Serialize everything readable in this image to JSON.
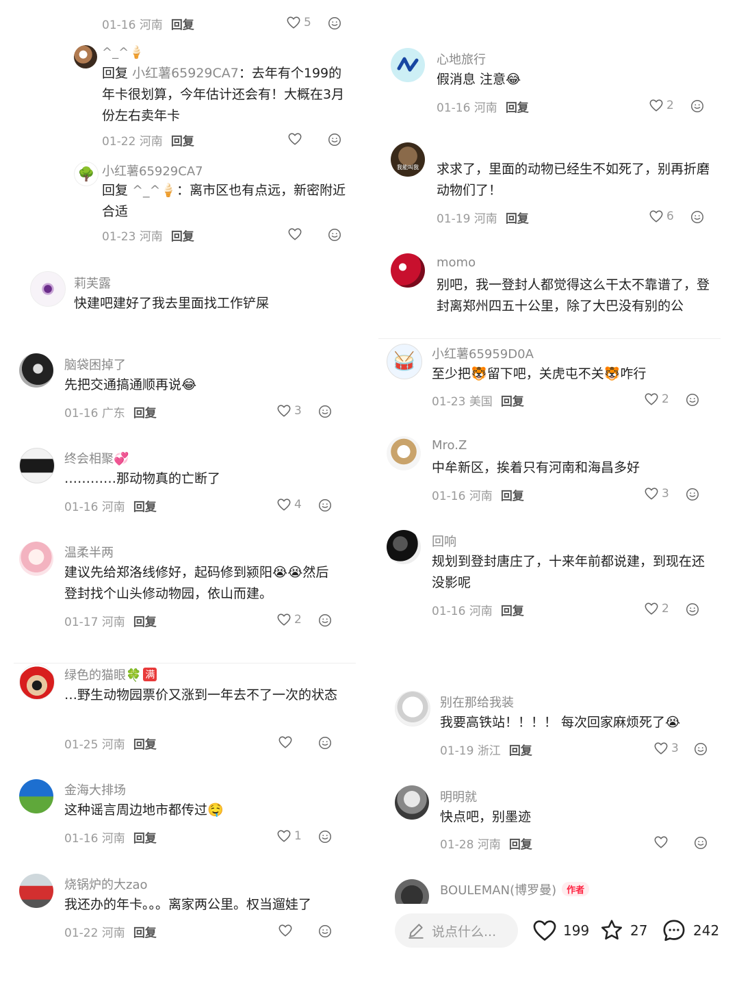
{
  "left": {
    "c0": {
      "date": "01-16",
      "loc": "河南",
      "reply": "回复",
      "likes": "5"
    },
    "c1": {
      "user": "^_^",
      "user_emoji": "🍦",
      "reply_prefix": "回复",
      "reply_to": "小红薯65929CA7",
      "text": "：去年有个199的年卡很划算，今年估计还会有！大概在3月份左右卖年卡",
      "date": "01-22",
      "loc": "河南",
      "reply": "回复",
      "likes": ""
    },
    "c2": {
      "user": "小红薯65929CA7",
      "reply_prefix": "回复",
      "reply_to": "^_^",
      "text_emoji": "🍦",
      "text": "：离市区也有点远，新密附近合适",
      "date": "01-23",
      "loc": "河南",
      "reply": "回复",
      "likes": ""
    },
    "c3": {
      "user": "莉芙露",
      "text": "快建吧建好了我去里面找工作铲屎"
    },
    "c4": {
      "user": "脑袋困掉了",
      "text": "先把交通搞通顺再说",
      "text_emoji": "😂",
      "date": "01-16",
      "loc": "广东",
      "reply": "回复",
      "likes": "3"
    },
    "c5": {
      "user": "终会相聚",
      "user_emoji": "💞",
      "text": "…………那动物真的亡断了",
      "date": "01-16",
      "loc": "河南",
      "reply": "回复",
      "likes": "4"
    },
    "c6": {
      "user": "温柔半两",
      "text_a": "建议先给郑洛线修好，起码修到颍阳",
      "emoji_a": "😭😭",
      "text_b": "然后登封找个山头修动物园，依山而建。",
      "date": "01-17",
      "loc": "河南",
      "reply": "回复",
      "likes": "2"
    },
    "c7": {
      "user": "绿色的猫眼",
      "user_emoji": "🍀",
      "user_tag": "满",
      "text": "…野生动物园票价又涨到一年去不了一次的状态",
      "date": "01-25",
      "loc": "河南",
      "reply": "回复",
      "likes": ""
    },
    "c8": {
      "user": "金海大排场",
      "text": "这种谣言周边地市都传过",
      "text_emoji": "🤤",
      "date": "01-16",
      "loc": "河南",
      "reply": "回复",
      "likes": "1"
    },
    "c9": {
      "user": "烧锅炉的大zao",
      "text": "我还办的年卡。。。离家两公里。权当遛娃了",
      "date": "01-22",
      "loc": "河南",
      "reply": "回复",
      "likes": ""
    }
  },
  "right": {
    "r1": {
      "user": "心地旅行",
      "text": "假消息 注意",
      "text_emoji": "😂",
      "date": "01-16",
      "loc": "河南",
      "reply": "回复",
      "likes": "2"
    },
    "r2": {
      "user": "",
      "avatar_text": "我能叫我",
      "text": "求求了，里面的动物已经生不如死了，别再折磨动物们了！",
      "date": "01-19",
      "loc": "河南",
      "reply": "回复",
      "likes": "6"
    },
    "r3": {
      "user": "momo",
      "text": "别吧，我一登封人都觉得这么干太不靠谱了，登封离郑州四五十公里，除了大巴没有别的公"
    },
    "r4": {
      "user": "小红薯65959D0A",
      "text_a": "至少把",
      "emoji_a": "🐯",
      "text_b": "留下吧，关虎屯不关",
      "emoji_b": "🐯",
      "text_c": "咋行",
      "date": "01-23",
      "loc": "美国",
      "reply": "回复",
      "likes": "2"
    },
    "r5": {
      "user": "Mro.Z",
      "text": "中牟新区，挨着只有河南和海昌多好",
      "date": "01-16",
      "loc": "河南",
      "reply": "回复",
      "likes": "3"
    },
    "r6": {
      "user": "回响",
      "text": "规划到登封唐庄了，十来年前都说建，到现在还没影呢",
      "date": "01-16",
      "loc": "河南",
      "reply": "回复",
      "likes": "2"
    },
    "r7": {
      "user": "别在那给我装",
      "text": "我要高铁站！！！！ 每次回家麻烦死了",
      "text_emoji": "😭",
      "date": "01-19",
      "loc": "浙江",
      "reply": "回复",
      "likes": "3"
    },
    "r8": {
      "user": "明明就",
      "text": "快点吧，别墨迹",
      "date": "01-28",
      "loc": "河南",
      "reply": "回复",
      "likes": ""
    },
    "r9": {
      "user": "BOULEMAN(博罗曼)",
      "badge": "作者"
    }
  },
  "bottom_bar": {
    "placeholder": "说点什么...",
    "likes": "199",
    "stars": "27",
    "comments": "242"
  },
  "icons": {
    "heart": "heart-icon",
    "emoji": "emoji-reaction-icon",
    "pen": "pen-icon",
    "star": "star-icon",
    "chat": "chat-bubble-icon"
  },
  "colors": {
    "accent": "#ff2442",
    "muted": "#8a8a8a",
    "text": "#222222"
  }
}
